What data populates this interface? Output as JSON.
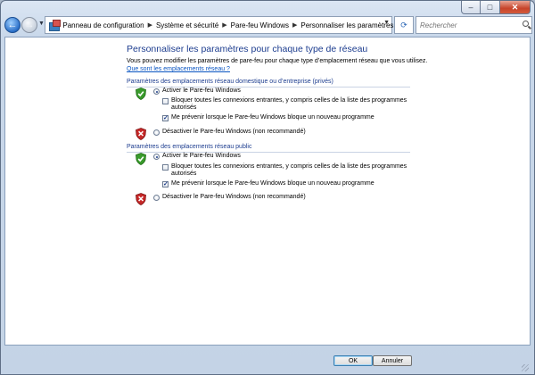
{
  "window": {
    "caption": {
      "minimize": "–",
      "maximize": "□",
      "close": "✕"
    }
  },
  "addressbar": {
    "back_glyph": "←",
    "forward_glyph": "→",
    "breadcrumbs": [
      "Panneau de configuration",
      "Système et sécurité",
      "Pare-feu Windows",
      "Personnaliser les paramètres"
    ],
    "search_placeholder": "Rechercher",
    "icons": {
      "app": "control-panel-icon",
      "refresh": "refresh-icon",
      "search": "search-icon"
    }
  },
  "main": {
    "title": "Personnaliser les paramètres pour chaque type de réseau",
    "description": "Vous pouvez modifier les paramètres de pare-feu pour chaque type d’emplacement réseau que vous utilisez.",
    "help_link": "Que sont les emplacements réseau ?",
    "sections": [
      {
        "title": "Paramètres des emplacements réseau domestique ou d’entreprise (privés)",
        "enable_label": "Activer le Pare-feu Windows",
        "enable_selected": true,
        "block_all_label": "Bloquer toutes les connexions entrantes, y compris celles de la liste des programmes autorisés",
        "block_all_checked": false,
        "notify_label": "Me prévenir lorsque le Pare-feu Windows bloque un nouveau programme",
        "notify_checked": true,
        "disable_label": "Désactiver le Pare-feu Windows (non recommandé)",
        "disable_selected": false
      },
      {
        "title": "Paramètres des emplacements réseau public",
        "enable_label": "Activer le Pare-feu Windows",
        "enable_selected": true,
        "block_all_label": "Bloquer toutes les connexions entrantes, y compris celles de la liste des programmes autorisés",
        "block_all_checked": false,
        "notify_label": "Me prévenir lorsque le Pare-feu Windows bloque un nouveau programme",
        "notify_checked": true,
        "disable_label": "Désactiver le Pare-feu Windows (non recommandé)",
        "disable_selected": false
      }
    ],
    "icons": {
      "on": "green-shield-check-icon",
      "off": "red-shield-x-icon"
    }
  },
  "footer": {
    "ok_label": "OK",
    "cancel_label": "Annuler"
  },
  "colors": {
    "title_blue": "#1d3d8f",
    "link_blue": "#0a55c2",
    "shield_green": "#3a9b2c",
    "shield_red": "#c62828"
  }
}
